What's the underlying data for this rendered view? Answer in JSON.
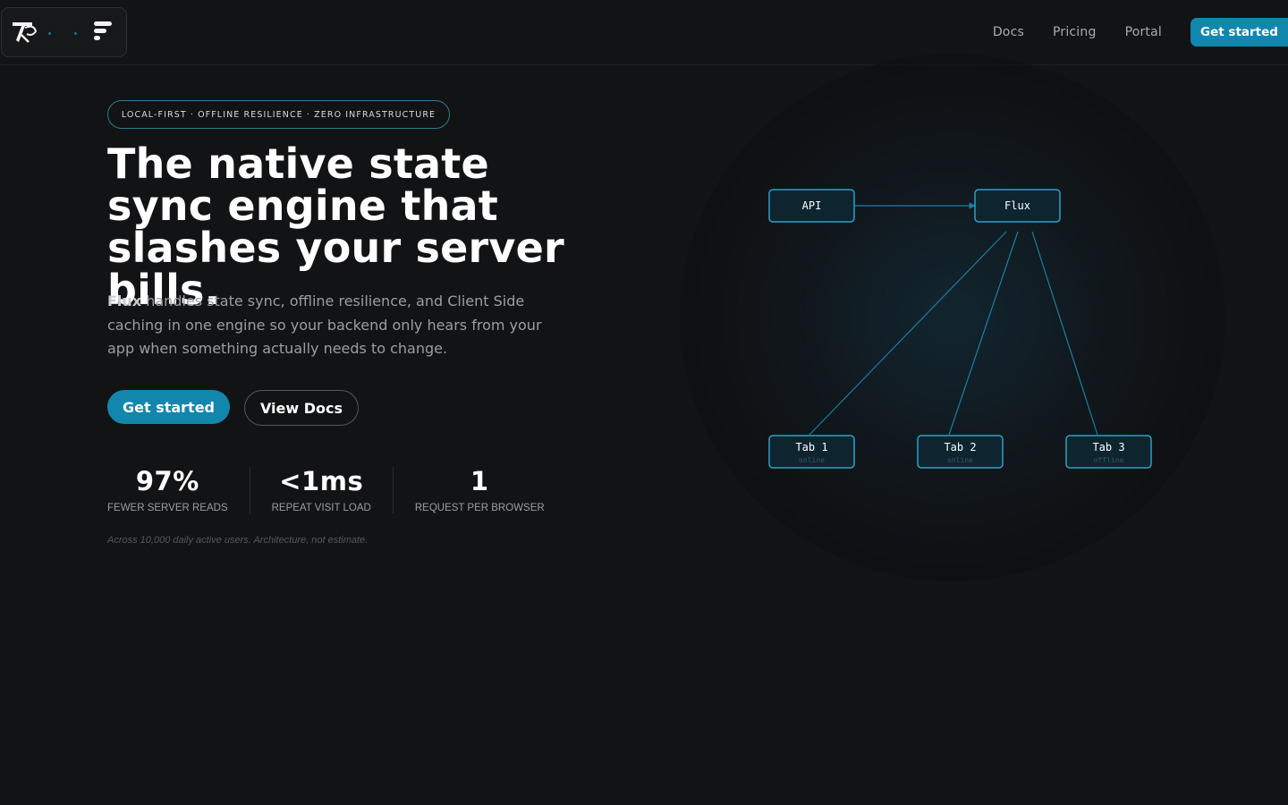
{
  "header": {
    "nav": [
      {
        "label": "Docs"
      },
      {
        "label": "Pricing"
      },
      {
        "label": "Portal"
      }
    ],
    "cta_label": "Get started"
  },
  "hero": {
    "badge": "LOCAL-FIRST · OFFLINE RESILIENCE · ZERO INFRASTRUCTURE",
    "headline": "The native state sync engine that slashes your server bills.",
    "lead_brand": "Flux",
    "lead_text": " handles state sync, offline resilience, and Client Side caching in one engine so your backend only hears from your app when something actually needs to change.",
    "primary_label": "Get started",
    "secondary_label": "View Docs",
    "stats": [
      {
        "value": "97%",
        "label": "FEWER SERVER READS"
      },
      {
        "value": "<1ms",
        "label": "REPEAT VISIT LOAD"
      },
      {
        "value": "1",
        "label": "REQUEST PER BROWSER"
      }
    ],
    "footnote": "Across 10,000 daily active users. Architecture, not estimate."
  },
  "diagram": {
    "nodes": {
      "api": {
        "label": "API"
      },
      "flux": {
        "label": "Flux"
      },
      "tab1": {
        "label": "Tab 1",
        "status": "online"
      },
      "tab2": {
        "label": "Tab 2",
        "status": "online"
      },
      "tab3": {
        "label": "Tab 3",
        "status": "offline"
      }
    },
    "colors": {
      "accent": "#1287ad",
      "node_border": "#2f9ec4",
      "node_fill": "#0e2530",
      "edge": "#1a7fa3"
    }
  }
}
